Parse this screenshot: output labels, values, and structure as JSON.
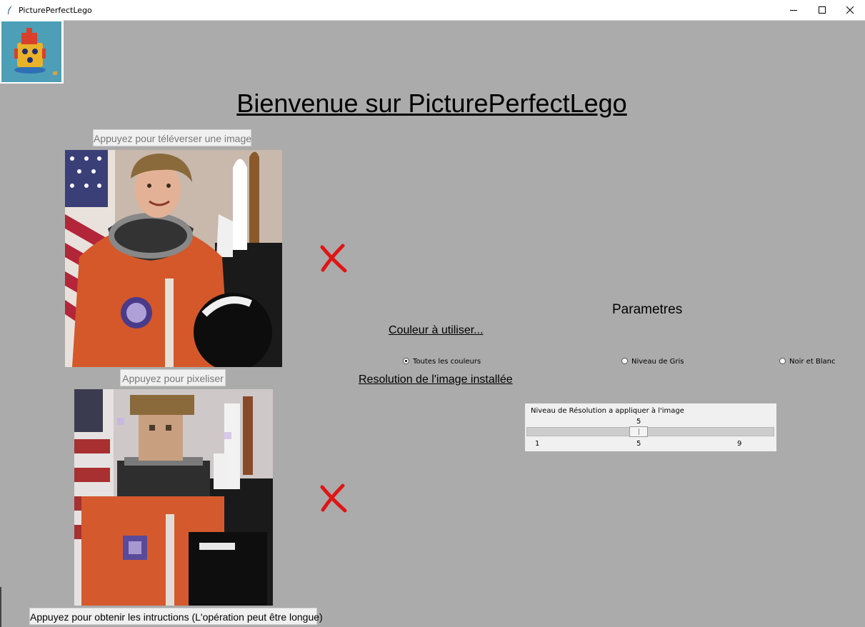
{
  "window": {
    "title": "PicturePerfectLego",
    "controls": {
      "minimize": "minimize-icon",
      "maximize": "maximize-icon",
      "close": "close-icon"
    }
  },
  "logo": {
    "alt": "lego-robot-logo"
  },
  "header": {
    "title": "Bienvenue sur PicturePerfectLego"
  },
  "upload": {
    "button_label": "Appuyez pour téléverser une image"
  },
  "pixelize": {
    "button_label": "Appuyez pour pixeliser"
  },
  "instructions": {
    "button_label": "Appuyez pour obtenir les intructions (L'opération peut être longue)"
  },
  "status_icons": {
    "original": "red-x-icon",
    "pixelized": "red-x-icon",
    "color": "#e01515"
  },
  "parameters": {
    "title": "Parametres",
    "color_label": "Couleur à utiliser...",
    "color_options": [
      {
        "label": "Toutes les couleurs",
        "selected": true
      },
      {
        "label": "Niveau de Gris",
        "selected": false
      },
      {
        "label": "Noir et Blanc",
        "selected": false
      }
    ],
    "resolution_label": "Resolution de l'image installée",
    "slider": {
      "label": "Niveau de Résolution a appliquer à l'image",
      "value": "5",
      "min": 1,
      "max": 9,
      "current": 5,
      "ticks": [
        "1",
        "5",
        "9"
      ]
    }
  },
  "colors": {
    "background": "#ababab",
    "panel": "#f0f0f0"
  }
}
